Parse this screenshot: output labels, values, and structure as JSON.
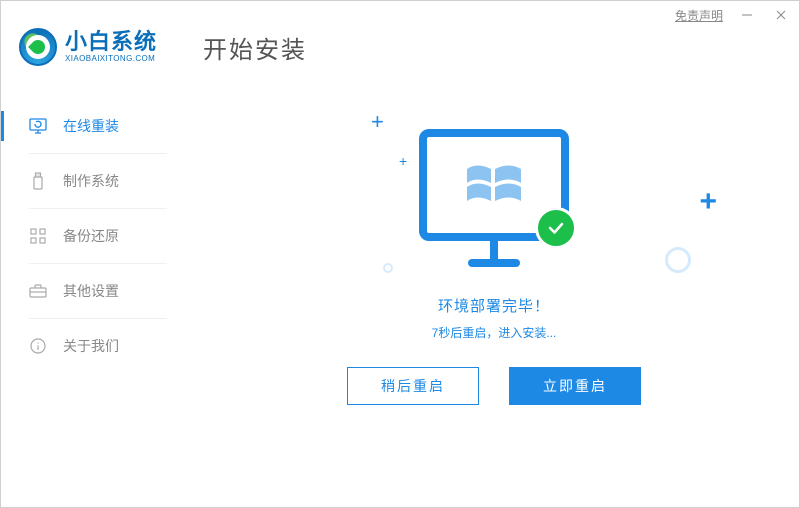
{
  "titlebar": {
    "disclaimer_label": "免责声明"
  },
  "brand": {
    "name_cn": "小白系统",
    "name_en": "XIAOBAIXITONG.COM"
  },
  "page_title": "开始安装",
  "sidebar": {
    "items": [
      {
        "label": "在线重装"
      },
      {
        "label": "制作系统"
      },
      {
        "label": "备份还原"
      },
      {
        "label": "其他设置"
      },
      {
        "label": "关于我们"
      }
    ]
  },
  "status": {
    "line1": "环境部署完毕！",
    "line2": "7秒后重启，进入安装..."
  },
  "buttons": {
    "later": "稍后重启",
    "now": "立即重启"
  }
}
